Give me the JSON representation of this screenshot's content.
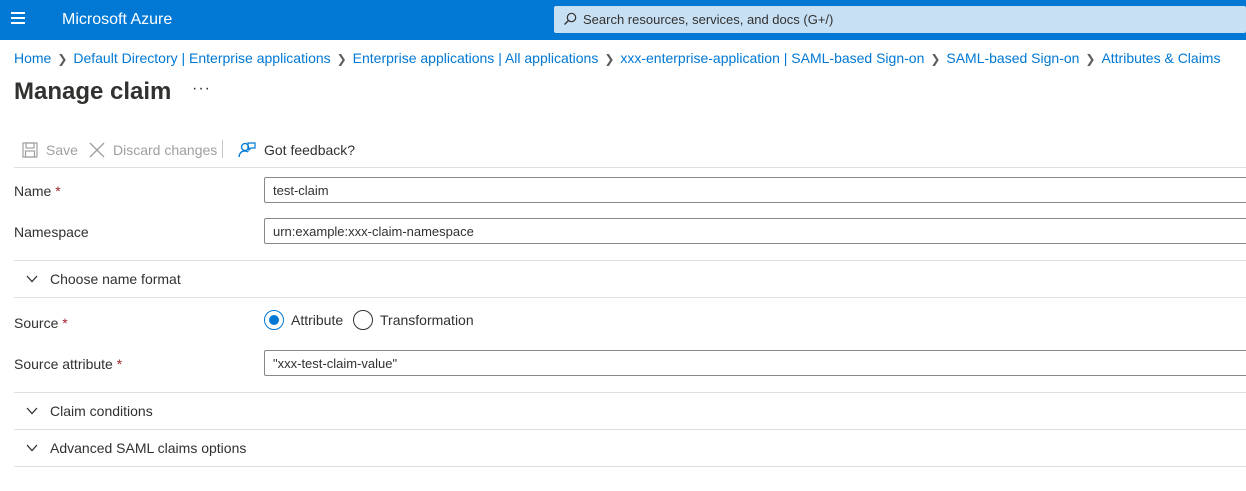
{
  "header": {
    "brand": "Microsoft Azure",
    "search_placeholder": "Search resources, services, and docs (G+/)"
  },
  "breadcrumb": [
    "Home",
    "Default Directory | Enterprise applications",
    "Enterprise applications | All applications",
    "xxx-enterprise-application | SAML-based Sign-on",
    "SAML-based Sign-on",
    "Attributes & Claims"
  ],
  "page": {
    "title": "Manage claim",
    "more_label": "···"
  },
  "toolbar": {
    "save_label": "Save",
    "discard_label": "Discard changes",
    "feedback_label": "Got feedback?"
  },
  "form": {
    "name_label": "Name",
    "name_value": "test-claim",
    "namespace_label": "Namespace",
    "namespace_value": "urn:example:xxx-claim-namespace",
    "name_format_section": "Choose name format",
    "source_label": "Source",
    "source_options": [
      "Attribute",
      "Transformation"
    ],
    "source_selected": "Attribute",
    "source_attribute_label": "Source attribute",
    "source_attribute_value": "\"xxx-test-claim-value\"",
    "required_marker": "*",
    "claim_conditions_section": "Claim conditions",
    "advanced_section": "Advanced SAML claims options"
  },
  "colors": {
    "brand_blue": "#0078d4",
    "search_bg": "#c7e0f4",
    "required_red": "#a4262c"
  }
}
